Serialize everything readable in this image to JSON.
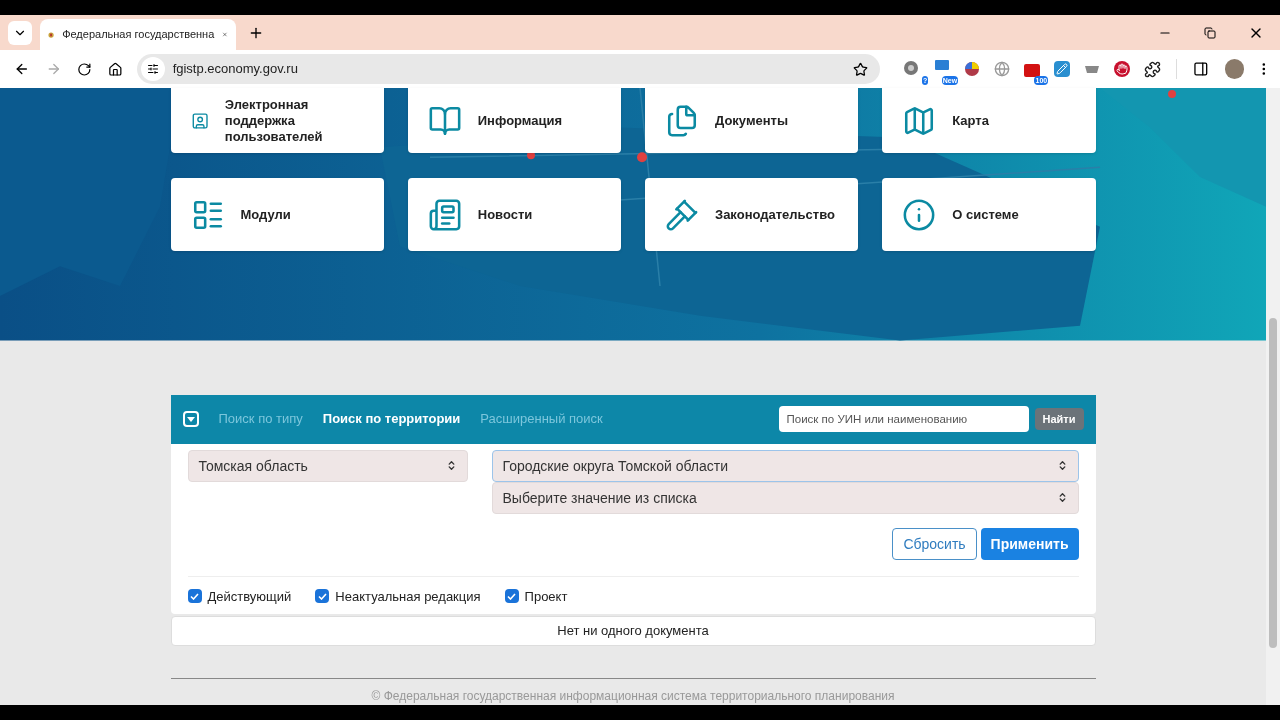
{
  "browser": {
    "tab_title": "Федеральная государственна",
    "url": "fgistp.economy.gov.ru",
    "extensions": [
      {
        "kind": "gear",
        "badge": "?"
      },
      {
        "kind": "new",
        "badge": "New"
      },
      {
        "kind": "pie"
      },
      {
        "kind": "globe"
      },
      {
        "kind": "counter",
        "badge": "100"
      },
      {
        "kind": "pen"
      },
      {
        "kind": "tray"
      },
      {
        "kind": "hand"
      },
      {
        "kind": "puzzle"
      }
    ]
  },
  "tiles": [
    {
      "label": "Электронная поддержка пользователей"
    },
    {
      "label": "Информация"
    },
    {
      "label": "Документы"
    },
    {
      "label": "Карта"
    },
    {
      "label": "Модули"
    },
    {
      "label": "Новости"
    },
    {
      "label": "Законодательство"
    },
    {
      "label": "О системе"
    }
  ],
  "search": {
    "tabs": [
      {
        "label": "Поиск по типу",
        "selected": false
      },
      {
        "label": "Поиск по территории",
        "selected": true
      },
      {
        "label": "Расширенный поиск",
        "selected": false
      }
    ],
    "query_placeholder": "Поиск по УИН или наименованию",
    "find_button": "Найти",
    "region_select": "Томская область",
    "district_select": "Городские округа Томской области",
    "value_select": "Выберите значение из списка",
    "reset_button": "Сбросить",
    "apply_button": "Применить",
    "filters": [
      {
        "label": "Действующий",
        "checked": true
      },
      {
        "label": "Неактуальная редакция",
        "checked": true
      },
      {
        "label": "Проект",
        "checked": true
      }
    ],
    "result": "Нет ни одного документа"
  },
  "footer": "© Федеральная государственная информационная система территориального планирования"
}
